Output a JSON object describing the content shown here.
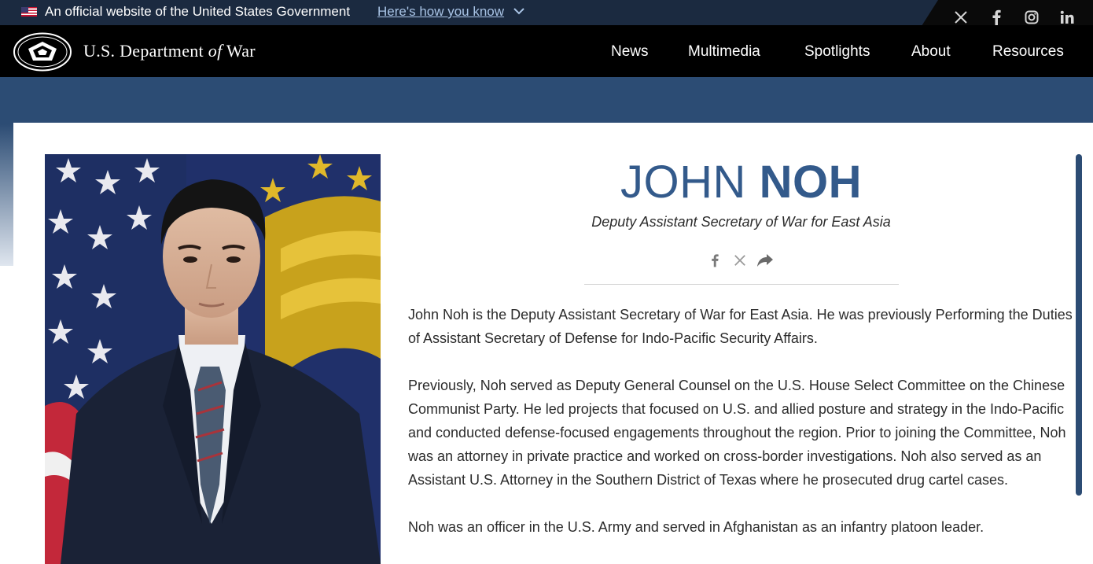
{
  "gov_banner": {
    "text": "An official website of the United States Government",
    "link": "Here's how you know"
  },
  "header": {
    "site_name_pre": "U.S. Department",
    "site_name_of": "of",
    "site_name_post": "War",
    "nav": [
      "News",
      "Multimedia",
      "Spotlights",
      "About",
      "Resources"
    ]
  },
  "social_icons": [
    "x-icon",
    "facebook-icon",
    "instagram-icon",
    "linkedin-icon"
  ],
  "profile": {
    "first_name": "JOHN",
    "last_name": "NOH",
    "title": "Deputy Assistant Secretary of War for East Asia",
    "share_icons": [
      "facebook-icon",
      "x-icon",
      "share-icon"
    ],
    "bio": [
      "John Noh is the Deputy Assistant Secretary of War for East Asia. He was previously Performing the Duties of Assistant Secretary of Defense for Indo-Pacific Security Affairs.",
      "Previously, Noh served as Deputy General Counsel on the U.S. House Select Committee on the Chinese Communist Party. He led projects that focused on U.S. and allied posture and strategy in the Indo-Pacific and conducted defense-focused engagements throughout the region. Prior to joining the Committee, Noh was an attorney in private practice and worked on cross-border investigations. Noh also served as an Assistant U.S. Attorney in the Southern District of Texas where he prosecuted drug cartel cases.",
      "Noh was an officer in the U.S. Army and served in Afghanistan as an infantry platoon leader."
    ]
  },
  "colors": {
    "accent": "#335a8b",
    "band": "#2c4c74",
    "header_bg": "#000000",
    "gov_banner_bg": "#1b2a40"
  }
}
